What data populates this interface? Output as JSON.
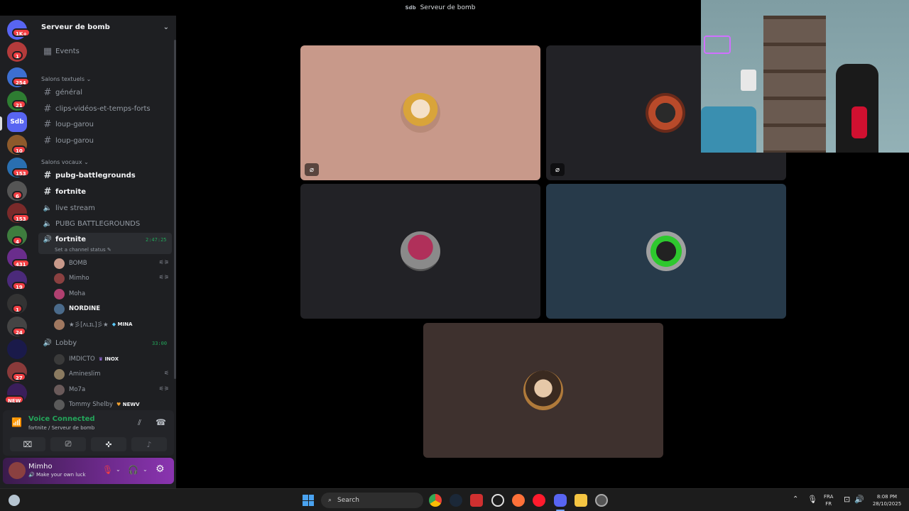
{
  "window": {
    "title": "Serveur de bomb",
    "logo_text": "Sdb"
  },
  "rail": {
    "badges": [
      "1K+",
      "1",
      "254",
      "21",
      "10",
      "153",
      "6",
      "153",
      "4",
      "431",
      "19",
      "1",
      "24",
      "27",
      "NEW"
    ],
    "sdb_label": "Sdb"
  },
  "server": {
    "name": "Serveur de bomb",
    "chevron_icon": "chevron-down-icon"
  },
  "events_label": "Events",
  "text_category": "Salons textuels",
  "text_channels": [
    "général",
    "clips-vidéos-et-temps-forts",
    "loup-garou",
    "loup-garou"
  ],
  "voice_category": "Salons vocaux",
  "voice_channels": {
    "c1": "pubg-battlegrounds",
    "c2": "fortnite",
    "c3": "live stream",
    "c4": "PUBG BATTLEGROUNDS"
  },
  "active_voice": {
    "name": "fortnite",
    "status": "Set a channel status",
    "timer": "2:47:25",
    "users": [
      "BOMB",
      "Mimho",
      "Moha",
      "NORDINE",
      "★彡[ʌʟɪʟ]彡★"
    ],
    "mina_tag": "MINA"
  },
  "lobby": {
    "name": "Lobby",
    "timer": "33:00",
    "users": [
      "IMDICTO",
      "Amineslim",
      "Mo7a",
      "Tommy Shelby"
    ],
    "inox_tag": "INOX",
    "newv_tag": "NEWV"
  },
  "voice_panel": {
    "title": "Voice Connected",
    "subtitle": "fortnite / Serveur de bomb"
  },
  "user_panel": {
    "name": "Mimho",
    "status": "Make your own luck"
  },
  "taskbar": {
    "search_placeholder": "Search",
    "lang_top": "FRA",
    "lang_bottom": "FR",
    "time": "8:08 PM",
    "date": "28/10/2025"
  },
  "colors": {
    "tile1": "#c8998a",
    "tile2": "#222226",
    "tile3": "#222226",
    "tile4": "#273a4a",
    "tile5": "#3e312e",
    "connected_green": "#23a55a",
    "badge_red": "#f23f43"
  }
}
